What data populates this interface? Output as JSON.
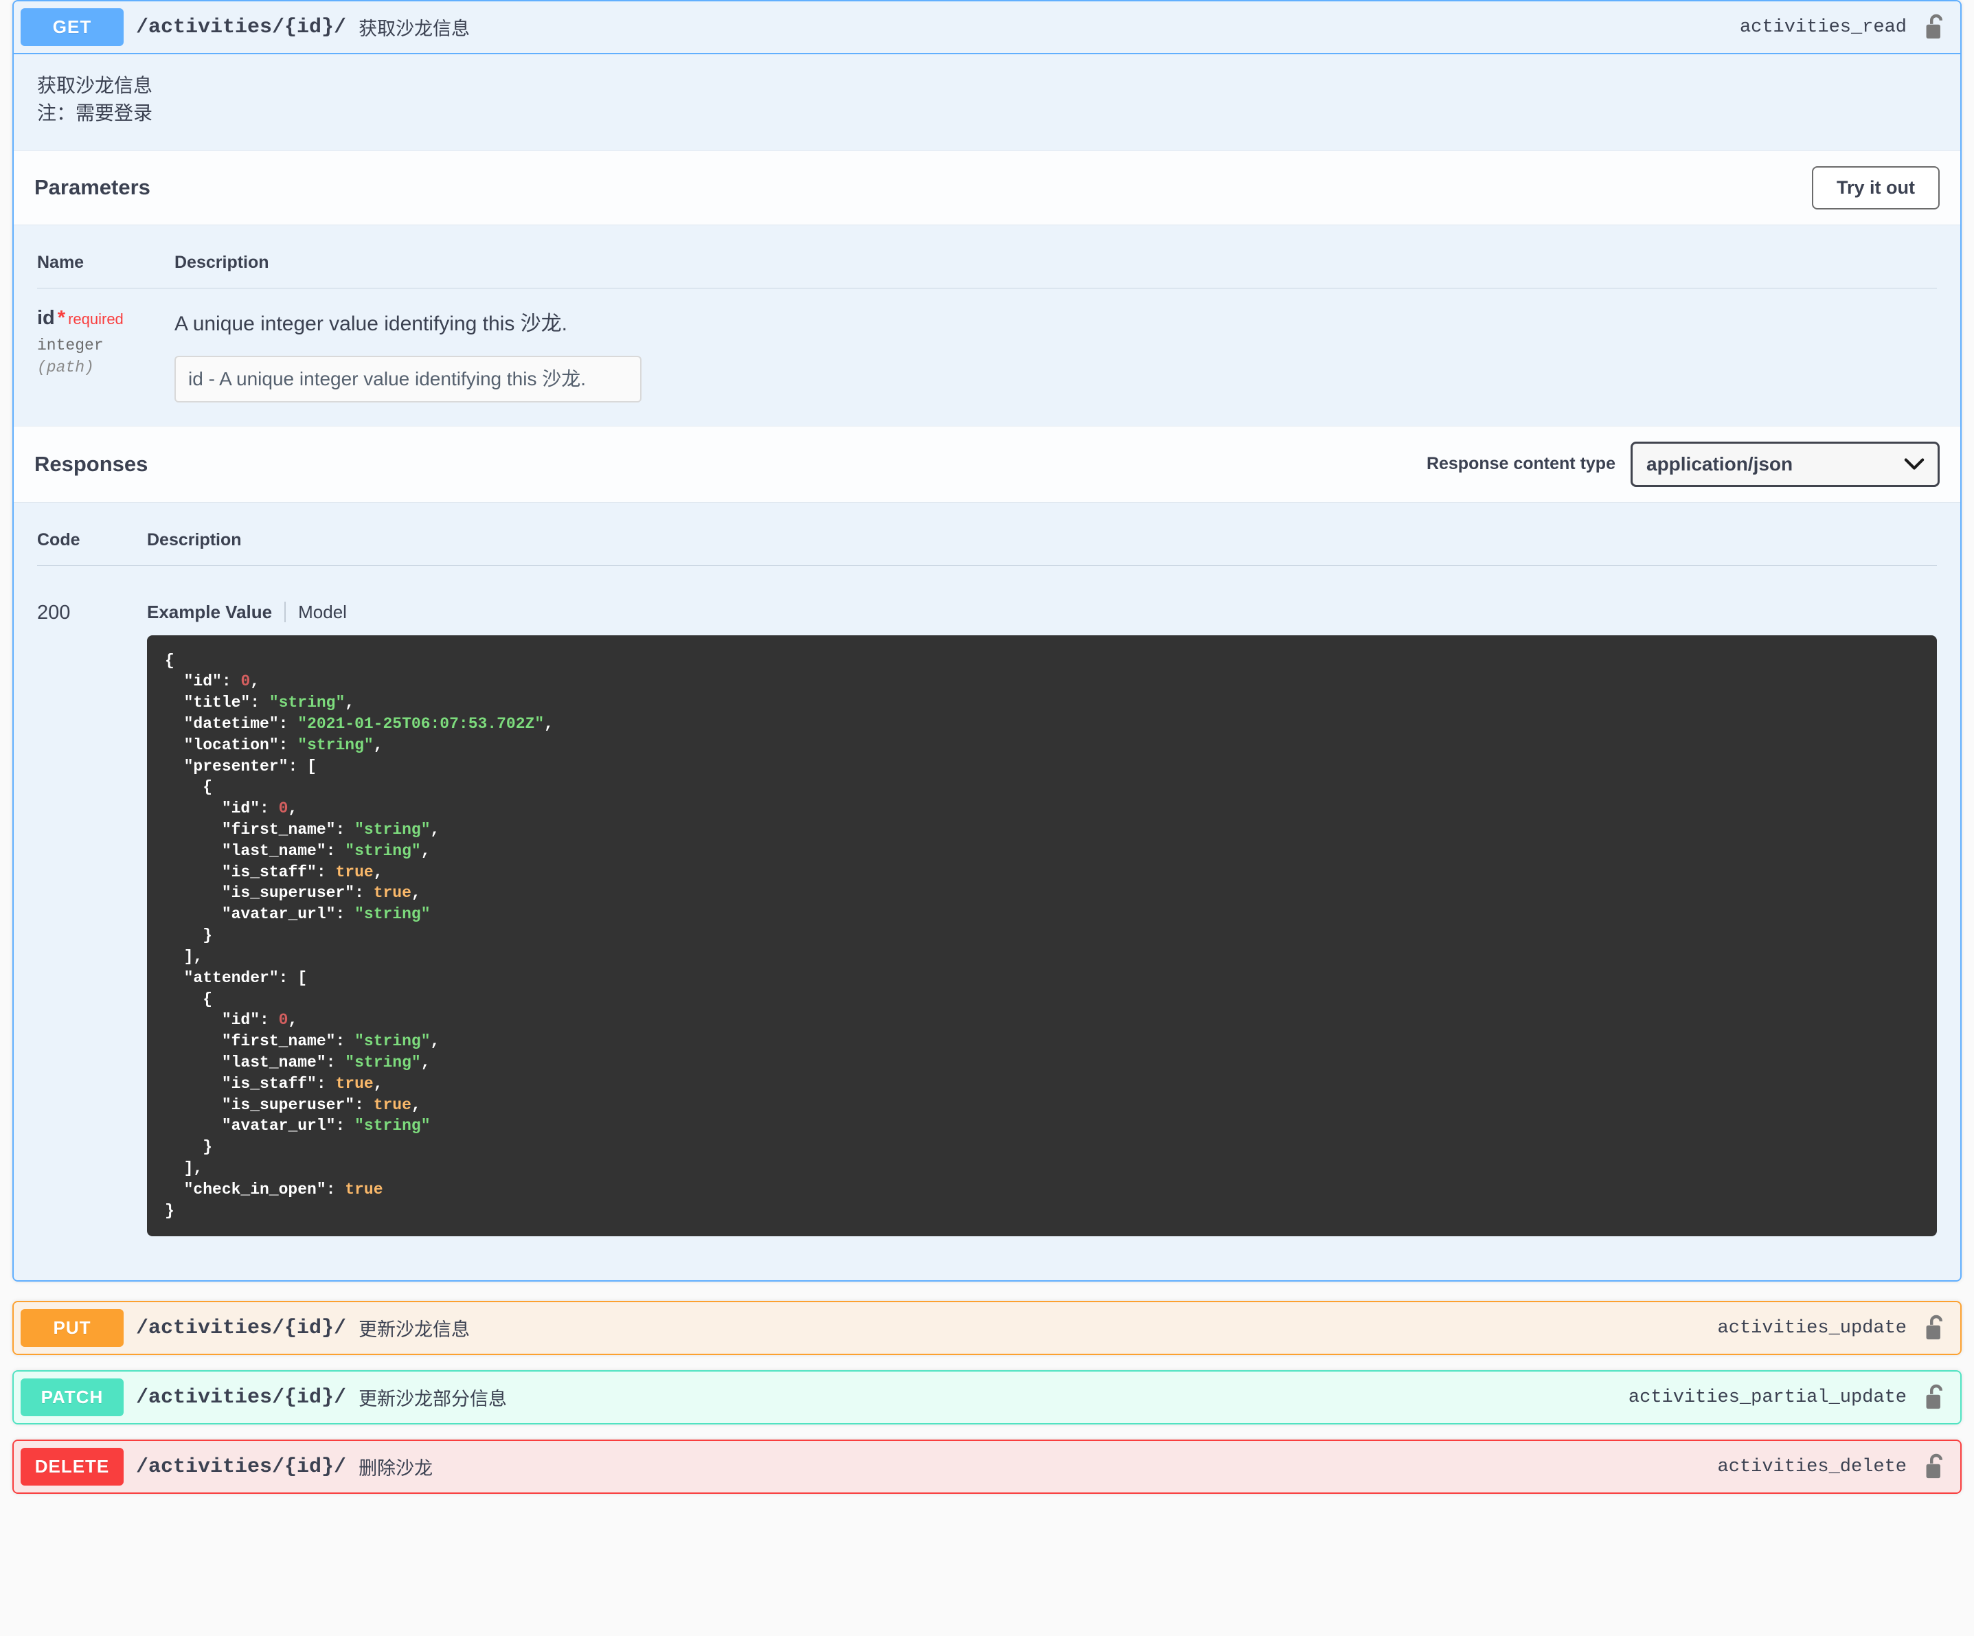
{
  "get_operation": {
    "method": "GET",
    "path": "/activities/{id}/",
    "summary": "获取沙龙信息",
    "operation_id": "activities_read",
    "lock_icon": "unlocked-padlock-icon",
    "description_line1": "获取沙龙信息",
    "description_line2": "注：需要登录",
    "parameters_section": {
      "title": "Parameters",
      "try_it_out_label": "Try it out",
      "columns": [
        "Name",
        "Description"
      ],
      "rows": [
        {
          "name": "id",
          "required_star": "*",
          "required_label": "required",
          "type": "integer",
          "in": "(path)",
          "description": "A unique integer value identifying this 沙龙.",
          "input_placeholder": "id - A unique integer value identifying this 沙龙.",
          "input_value": ""
        }
      ]
    },
    "responses_section": {
      "title": "Responses",
      "content_type_label": "Response content type",
      "content_type_value": "application/json",
      "content_type_options": [
        "application/json"
      ],
      "columns": [
        "Code",
        "Description"
      ],
      "rows": [
        {
          "code": "200",
          "tab_example": "Example Value",
          "tab_model": "Model",
          "example_value": "{\n  \"id\": 0,\n  \"title\": \"string\",\n  \"datetime\": \"2021-01-25T06:07:53.702Z\",\n  \"location\": \"string\",\n  \"presenter\": [\n    {\n      \"id\": 0,\n      \"first_name\": \"string\",\n      \"last_name\": \"string\",\n      \"is_staff\": true,\n      \"is_superuser\": true,\n      \"avatar_url\": \"string\"\n    }\n  ],\n  \"attender\": [\n    {\n      \"id\": 0,\n      \"first_name\": \"string\",\n      \"last_name\": \"string\",\n      \"is_staff\": true,\n      \"is_superuser\": true,\n      \"avatar_url\": \"string\"\n    }\n  ],\n  \"check_in_open\": true\n}"
        }
      ]
    }
  },
  "collapsed_operations": [
    {
      "method": "PUT",
      "path": "/activities/{id}/",
      "summary": "更新沙龙信息",
      "operation_id": "activities_update",
      "lock_icon": "unlocked-padlock-icon"
    },
    {
      "method": "PATCH",
      "path": "/activities/{id}/",
      "summary": "更新沙龙部分信息",
      "operation_id": "activities_partial_update",
      "lock_icon": "unlocked-padlock-icon"
    },
    {
      "method": "DELETE",
      "path": "/activities/{id}/",
      "summary": "删除沙龙",
      "operation_id": "activities_delete",
      "lock_icon": "unlocked-padlock-icon"
    }
  ],
  "colors": {
    "get": "#61affe",
    "put": "#fca130",
    "patch": "#50e3c2",
    "delete": "#f93e3e",
    "required": "#f93e3e",
    "code_background": "#333333",
    "string_token": "#7ddc7d",
    "number_token": "#d45f5f",
    "boolean_token": "#fbb96a"
  }
}
